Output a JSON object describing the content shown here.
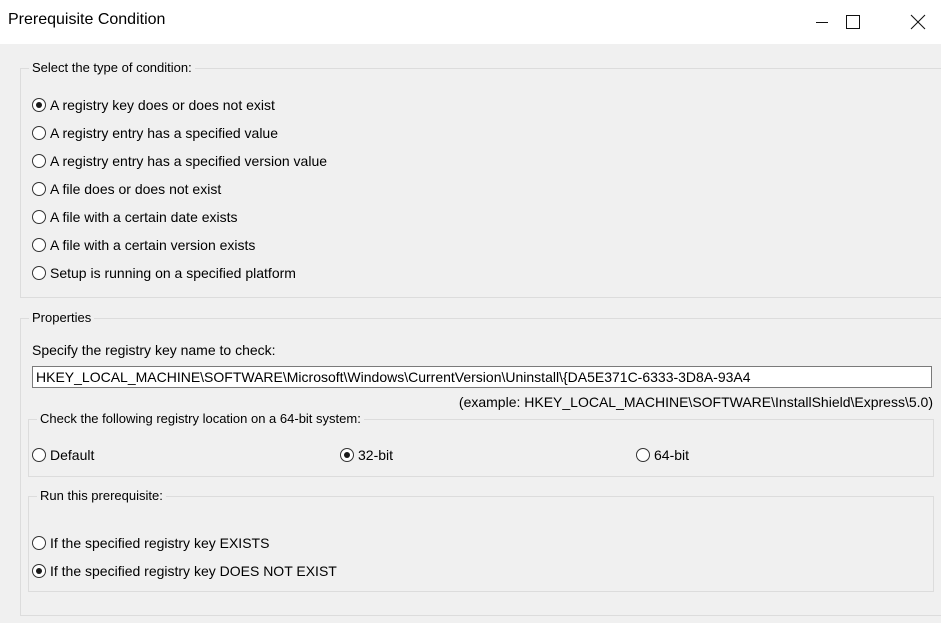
{
  "window": {
    "title": "Prerequisite Condition",
    "icons": [
      "minimize-icon",
      "maximize-icon",
      "close-icon"
    ]
  },
  "condition_group": {
    "legend": "Select the type of condition:",
    "options": [
      {
        "label": "A registry key does or does not exist",
        "checked": true
      },
      {
        "label": "A registry entry has a specified value",
        "checked": false
      },
      {
        "label": "A registry entry has a specified version value",
        "checked": false
      },
      {
        "label": "A file does or does not exist",
        "checked": false
      },
      {
        "label": "A file with a certain date exists",
        "checked": false
      },
      {
        "label": "A file with a certain version exists",
        "checked": false
      },
      {
        "label": "Setup is running on a specified platform",
        "checked": false
      }
    ]
  },
  "properties": {
    "legend": "Properties",
    "key_label": "Specify the registry key name to check:",
    "key_value": "HKEY_LOCAL_MACHINE\\SOFTWARE\\Microsoft\\Windows\\CurrentVersion\\Uninstall\\{DA5E371C-6333-3D8A-93A4",
    "example": "(example: HKEY_LOCAL_MACHINE\\SOFTWARE\\InstallShield\\Express\\5.0)",
    "location_group": {
      "legend": "Check the following registry location on a 64-bit system:",
      "options": [
        {
          "label": "Default",
          "checked": false
        },
        {
          "label": "32-bit",
          "checked": true
        },
        {
          "label": "64-bit",
          "checked": false
        }
      ]
    },
    "run_group": {
      "legend": "Run this prerequisite:",
      "options": [
        {
          "label": "If the specified registry key EXISTS",
          "checked": false
        },
        {
          "label": "If the specified registry key DOES NOT EXIST",
          "checked": true
        }
      ]
    }
  }
}
